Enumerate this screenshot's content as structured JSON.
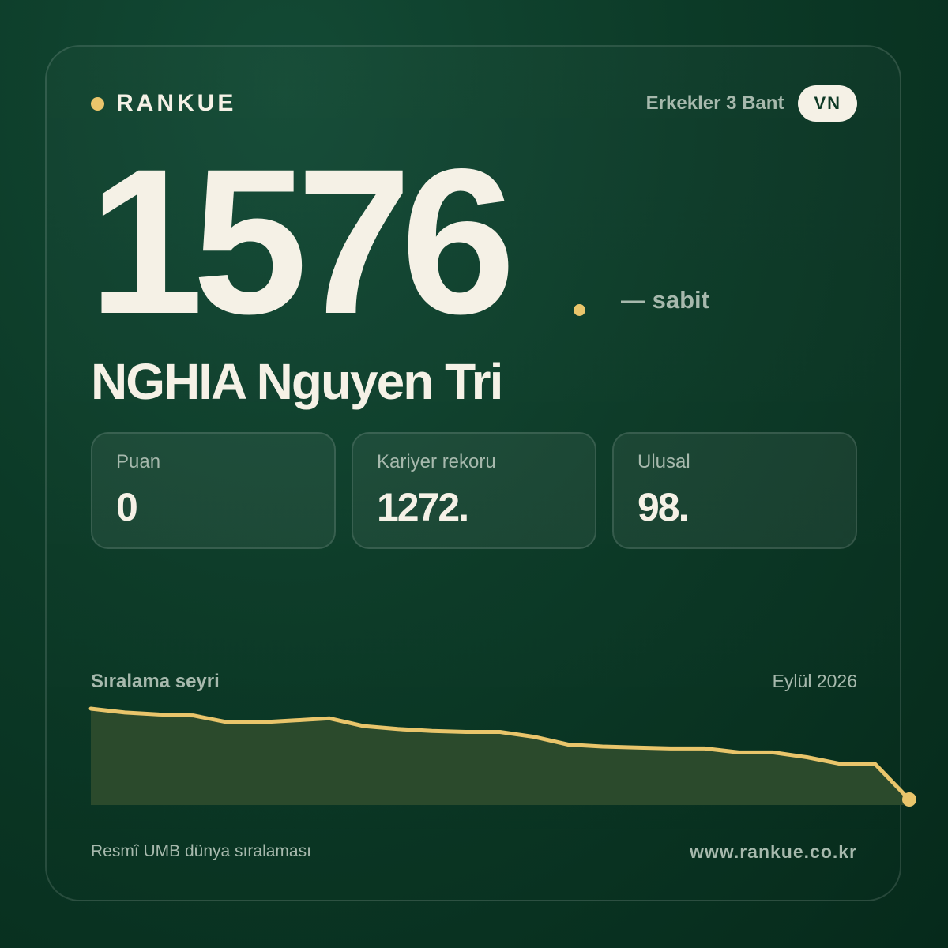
{
  "brand": {
    "name": "RANKUE"
  },
  "header": {
    "category": "Erkekler 3 Bant",
    "country_code": "VN"
  },
  "ranking": {
    "current_rank": "1576",
    "trend": "— sabit",
    "player_name": "NGHIA Nguyen Tri"
  },
  "stats": [
    {
      "label": "Puan",
      "value": "0"
    },
    {
      "label": "Kariyer rekoru",
      "value": "1272."
    },
    {
      "label": "Ulusal",
      "value": "98."
    }
  ],
  "chart": {
    "title": "Sıralama seyri",
    "date_label": "Eylül 2026"
  },
  "chart_data": {
    "type": "area",
    "title": "Sıralama seyri",
    "y_axis": "rank",
    "y_inverted": true,
    "ylim": [
      1476,
      1576
    ],
    "values": [
      1476,
      1480,
      1482,
      1483,
      1490,
      1490,
      1488,
      1486,
      1494,
      1497,
      1499,
      1500,
      1500,
      1505,
      1513,
      1515,
      1516,
      1517,
      1517,
      1521,
      1521,
      1526,
      1533,
      1533,
      1576
    ],
    "grid": false,
    "legend": "none",
    "line_color": "#e9c56b",
    "fill_color": "#2b4a2c"
  },
  "footer": {
    "source": "Resmî UMB dünya sıralaması",
    "website": "www.rankue.co.kr"
  },
  "colors": {
    "background": "#0c3a27",
    "accent": "#e9c56b",
    "text_primary": "#f5f1e6",
    "text_muted": "#a7b9ad"
  }
}
